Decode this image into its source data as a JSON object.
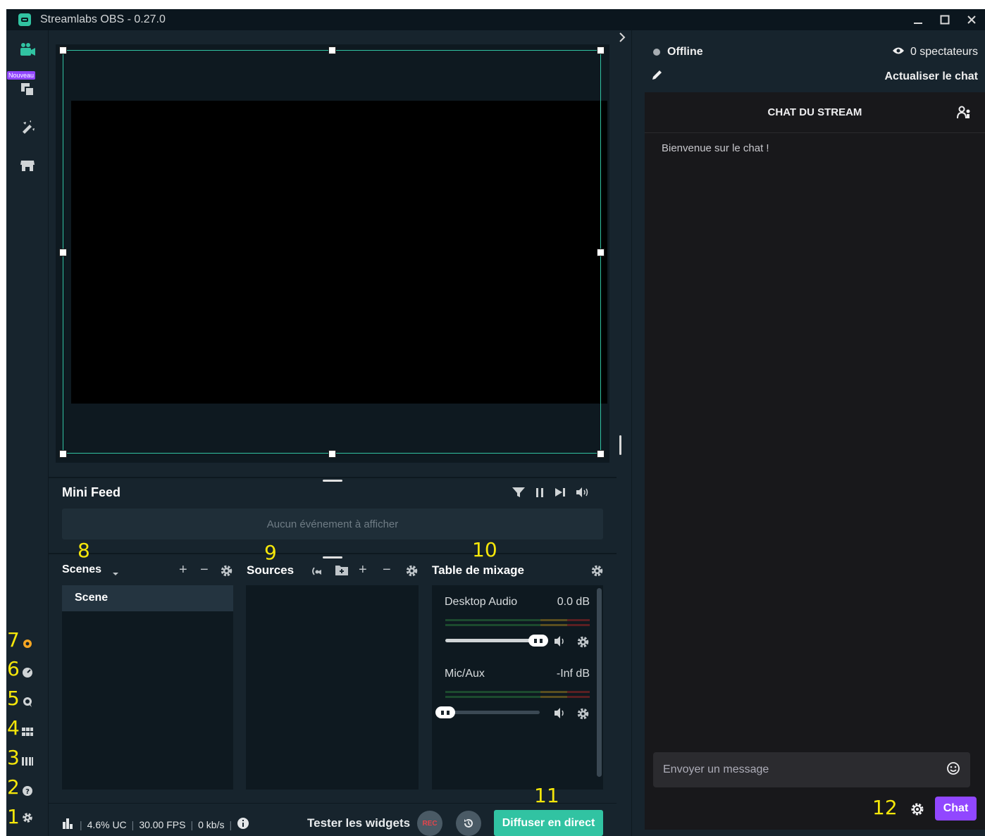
{
  "window": {
    "title": "Streamlabs OBS - 0.27.0"
  },
  "sidebar": {
    "badge": "Nouveau"
  },
  "annotations": {
    "n1": "1",
    "n2": "2",
    "n3": "3",
    "n4": "4",
    "n5": "5",
    "n6": "6",
    "n7": "7",
    "n8": "8",
    "n9": "9",
    "n10": "10",
    "n11": "11",
    "n12": "12"
  },
  "minifeed": {
    "title": "Mini Feed",
    "empty": "Aucun événement à afficher"
  },
  "scenes": {
    "title": "Scenes",
    "items": [
      "Scene"
    ]
  },
  "sources": {
    "title": "Sources"
  },
  "mixer": {
    "title": "Table de mixage",
    "channels": [
      {
        "name": "Desktop Audio",
        "value": "0.0 dB",
        "level": 1.0
      },
      {
        "name": "Mic/Aux",
        "value": "-Inf dB",
        "level": 0.0
      }
    ]
  },
  "footer": {
    "cpu": "4.6% UC",
    "fps": "30.00 FPS",
    "bitrate": "0 kb/s",
    "test_widgets": "Tester les widgets",
    "rec": "REC",
    "go_live": "Diffuser en direct"
  },
  "status": {
    "state": "Offline",
    "viewers": "0 spectateurs",
    "refresh_chat": "Actualiser le chat"
  },
  "chat": {
    "header": "CHAT DU STREAM",
    "welcome": "Bienvenue sur le chat !",
    "placeholder": "Envoyer un message",
    "button": "Chat"
  },
  "colors": {
    "accent": "#31c3a2",
    "twitch_purple": "#9147ff",
    "annotation": "#f5e60a",
    "background": "#17242d"
  }
}
